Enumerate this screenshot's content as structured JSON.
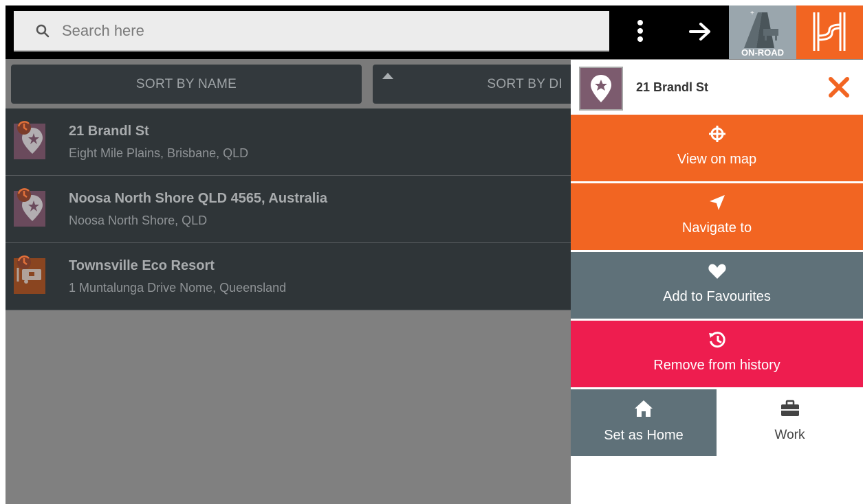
{
  "search": {
    "placeholder": "Search here"
  },
  "topbar": {
    "onroad_label": "ON-ROAD"
  },
  "sort": {
    "by_name": "SORT BY NAME",
    "by_distance": "SORT BY DI"
  },
  "list": [
    {
      "title": "21 Brandl St",
      "subtitle": "Eight Mile Plains, Brisbane, QLD",
      "icon": "history-favourite-pin-icon"
    },
    {
      "title": "Noosa North Shore QLD 4565, Australia",
      "subtitle": "Noosa North Shore, QLD",
      "icon": "history-favourite-pin-icon"
    },
    {
      "title": "Townsville Eco Resort",
      "subtitle": "1 Muntalunga Drive Nome, Queensland",
      "icon": "history-caravan-icon"
    }
  ],
  "panel": {
    "title": "21 Brandl St",
    "view_on_map": "View on map",
    "navigate_to": "Navigate to",
    "add_to_favourites": "Add to Favourites",
    "remove_from_history": "Remove from history",
    "set_as_home": "Set as Home",
    "work": "Work"
  },
  "colors": {
    "accent_orange": "#f26522",
    "slate": "#5f7179",
    "remove_red": "#ee1d4f",
    "list_bg": "#2f3538"
  }
}
